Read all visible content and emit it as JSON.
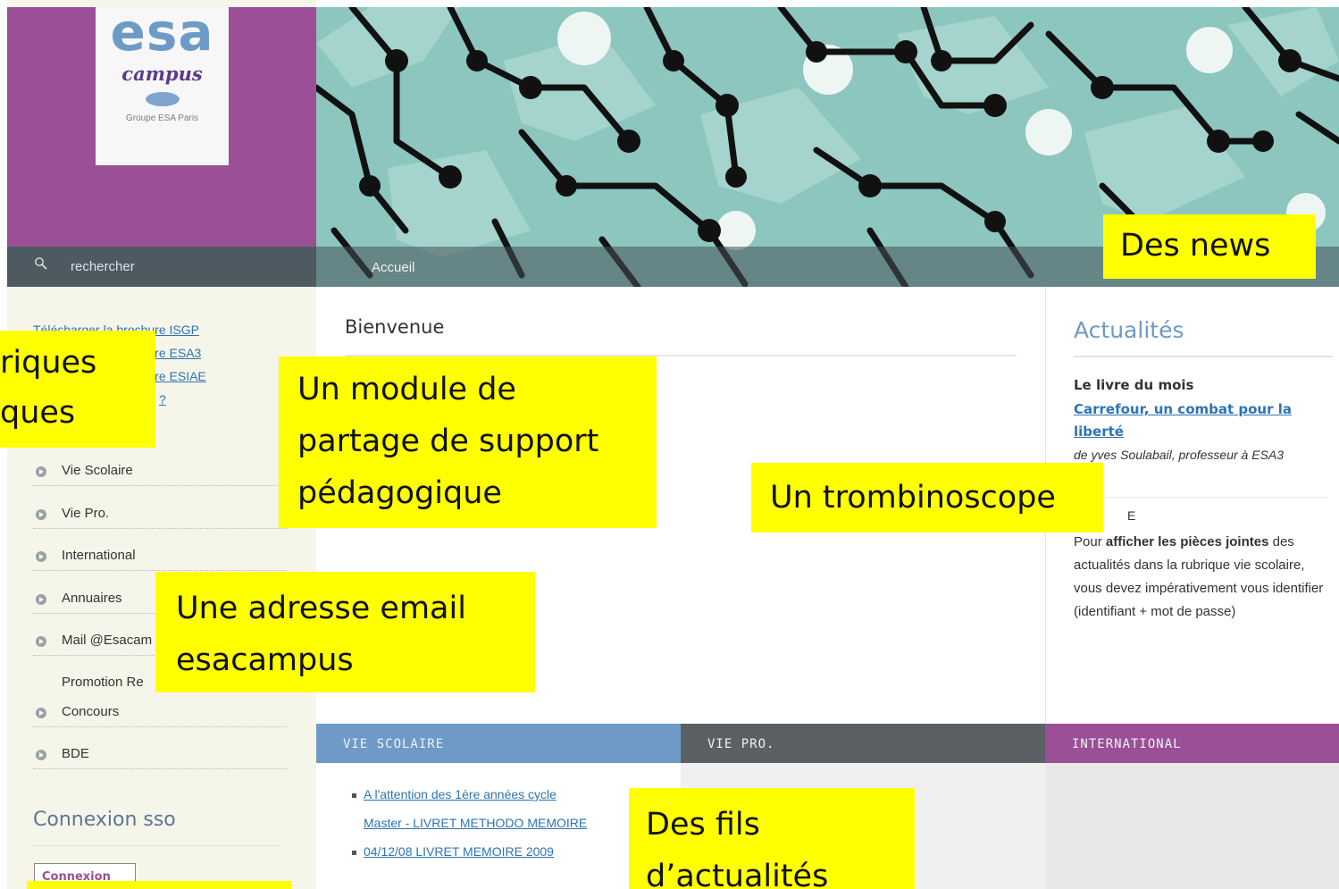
{
  "logo": {
    "esa": "esa",
    "campus": "campus",
    "group": "Groupe ESA Paris"
  },
  "search": {
    "label": "rechercher"
  },
  "breadcrumb": {
    "home": "Accueil"
  },
  "brochures": [
    "Télécharger la brochure ISGP",
    "Télécharger la brochure ESA3",
    "Télécharger la brochure ESIAE",
    "?"
  ],
  "menu": {
    "items": [
      {
        "label": "Vie Scolaire",
        "bullet": true
      },
      {
        "label": "Vie Pro.",
        "bullet": true
      },
      {
        "label": "International",
        "bullet": true
      },
      {
        "label": "Annuaires",
        "bullet": true
      },
      {
        "label": "Mail @Esacam",
        "bullet": true
      },
      {
        "label": "Promotion Re",
        "bullet": false
      },
      {
        "label": "Concours",
        "bullet": true
      },
      {
        "label": "BDE",
        "bullet": true
      }
    ]
  },
  "sso": {
    "title": "Connexion sso",
    "button": "Connexion"
  },
  "main": {
    "title": "Bienvenue"
  },
  "news": {
    "title": "Actualités",
    "book_label": "Le livre du mois",
    "book_link_line1": "Carrefour, un combat pour la",
    "book_link_line2": "liberté",
    "book_author": "de yves Soulabail, professeur à ESA3",
    "note_fragment": "E",
    "note_before": "Pour ",
    "note_bold": "afficher les pièces jointes",
    "note_after": " des actualités dans la rubrique vie scolaire, vous devez impérativement vous identifier (identifiant + mot de passe)"
  },
  "feeds": {
    "vie_scolaire": "VIE SCOLAIRE",
    "vie_pro": "VIE PRO.",
    "international": "INTERNATIONAL",
    "items": [
      "A l'attention des 1ère années cycle",
      "Master - LIVRET METHODO MEMOIRE",
      "04/12/08 LIVRET MEMOIRE 2009"
    ]
  },
  "callouts": {
    "rubriques_line1": "riques",
    "rubriques_line2": "ques",
    "module_line1": "Un module de",
    "module_line2": "partage de support",
    "module_line3": "pédagogique",
    "news": "Des news",
    "trombinoscope": "Un trombinoscope",
    "email_line1": "Une adresse email",
    "email_line2": "esacampus",
    "fils_line1": "Des fils",
    "fils_line2": "d’actualités"
  },
  "colors": {
    "purple": "#9b4f96",
    "blue": "#6d9ac7",
    "link": "#2d74b4",
    "dark_bar": "#4e5a62",
    "highlight": "#ffff00"
  }
}
